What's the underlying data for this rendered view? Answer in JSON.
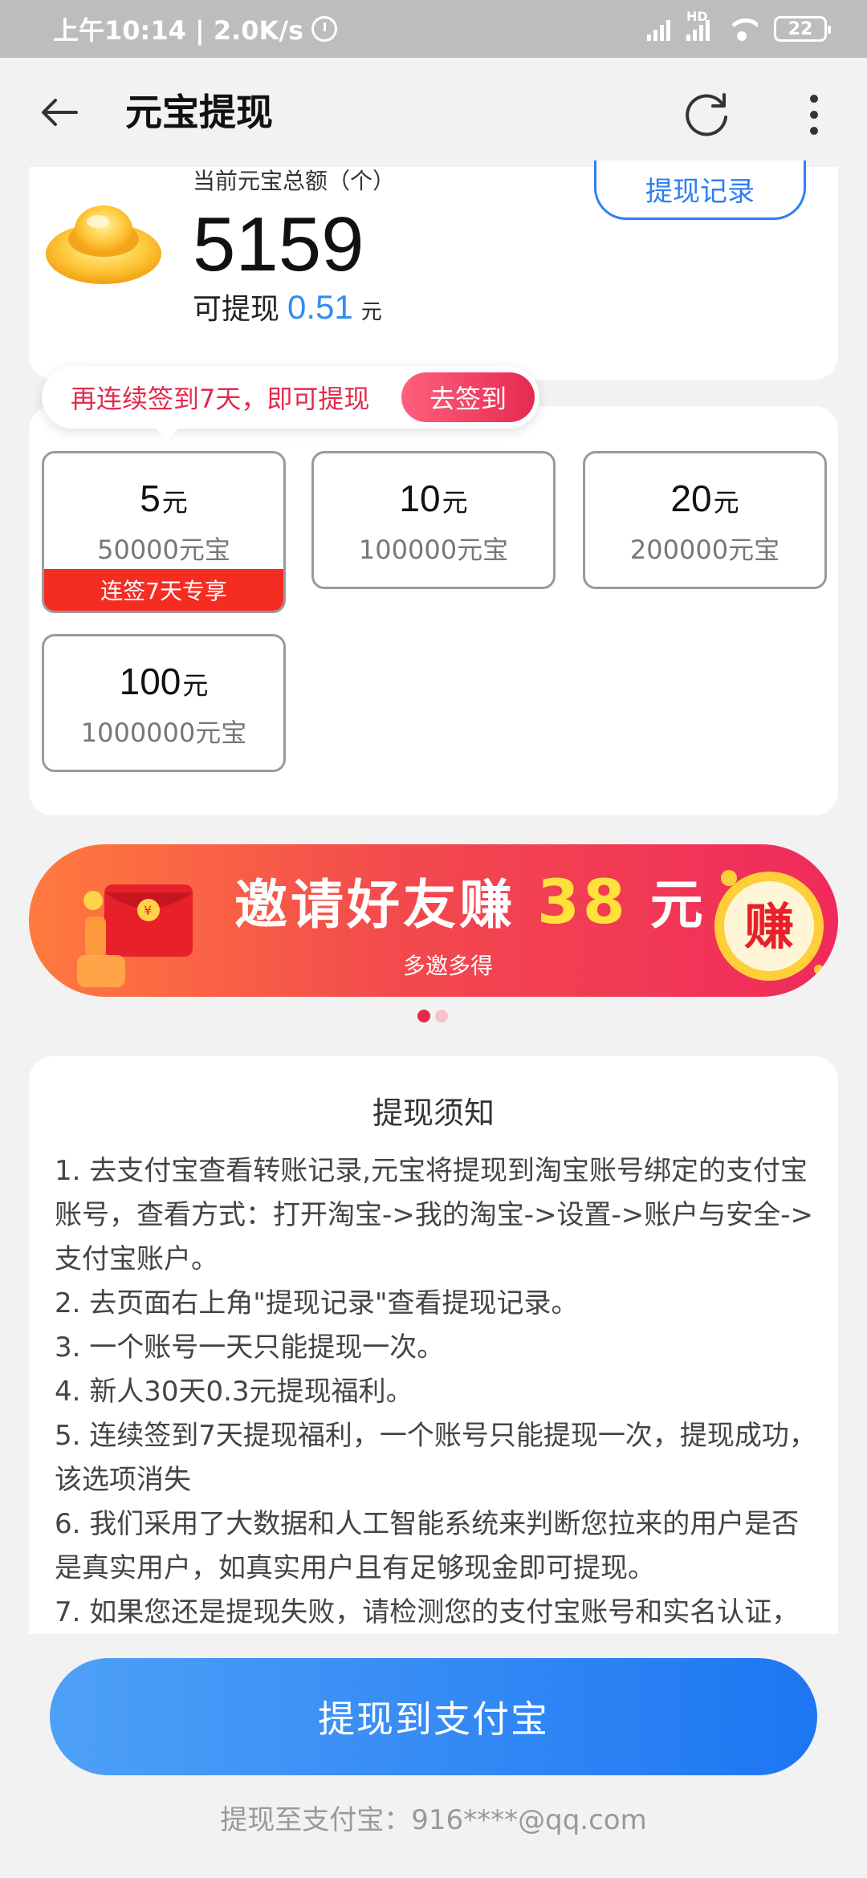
{
  "status_bar": {
    "time_speed": "上午10:14 | 2.0K/s",
    "network_hd": "HD",
    "battery": "22"
  },
  "header": {
    "title": "元宝提现"
  },
  "balance": {
    "label": "当前元宝总额（个）",
    "value": "5159",
    "available_label": "可提现",
    "available_amount": "0.51",
    "available_unit": "元",
    "record_button": "提现记录"
  },
  "signin_tip": {
    "text": "再连续签到7天，即可提现",
    "button": "去签到"
  },
  "options": [
    {
      "amount": "5",
      "unit": "元",
      "ingots": "50000元宝",
      "tag": "连签7天专享"
    },
    {
      "amount": "10",
      "unit": "元",
      "ingots": "100000元宝"
    },
    {
      "amount": "20",
      "unit": "元",
      "ingots": "200000元宝"
    },
    {
      "amount": "100",
      "unit": "元",
      "ingots": "1000000元宝"
    }
  ],
  "banner": {
    "title_prefix": "邀请好友赚",
    "title_amount": "38",
    "title_unit": "元",
    "subtitle": "多邀多得",
    "badge": "赚",
    "colors": {
      "start": "#ff7a3e",
      "end": "#f02a5c",
      "highlight": "#ffe13b"
    }
  },
  "notice": {
    "title": "提现须知",
    "items": [
      "1. 去支付宝查看转账记录,元宝将提现到淘宝账号绑定的支付宝账号，查看方式：打开淘宝->我的淘宝->设置->账户与安全->支付宝账户。",
      "2. 去页面右上角\"提现记录\"查看提现记录。",
      "3. 一个账号一天只能提现一次。",
      "4. 新人30天0.3元提现福利。",
      "5. 连续签到7天提现福利，一个账号只能提现一次，提现成功，该选项消失",
      "6. 我们采用了大数据和人工智能系统来判断您拉来的用户是否是真实用户，如真实用户且有足够现金即可提现。",
      "7. 如果您还是提现失败，请检测您的支付宝账号和实名认证，"
    ]
  },
  "footer": {
    "withdraw_button": "提现到支付宝",
    "account_line": "提现至支付宝：916****@qq.com"
  },
  "colors": {
    "accent_blue": "#2f7ff4",
    "accent_red": "#e5294c",
    "tag_red": "#f42c22"
  }
}
